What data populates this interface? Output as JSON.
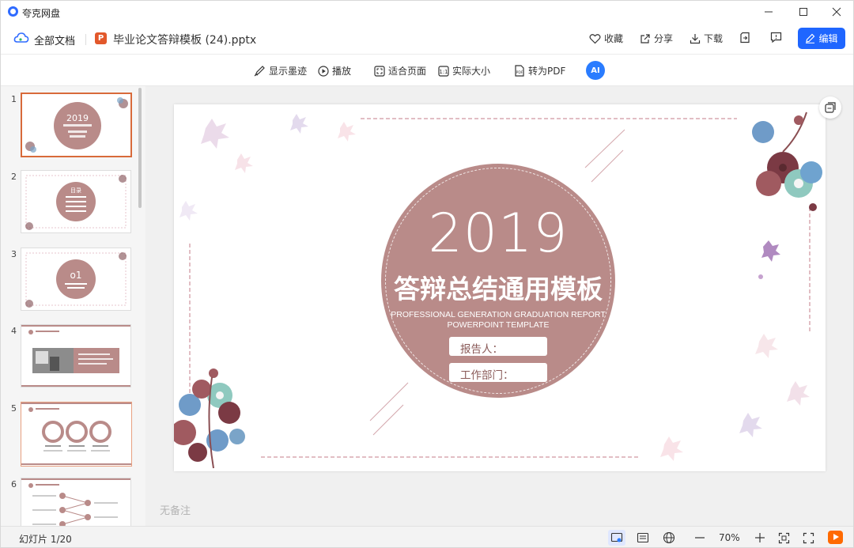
{
  "app": {
    "title": "夸克网盘"
  },
  "header": {
    "all_docs": "全部文档",
    "file_name": "毕业论文答辩模板 (24).pptx",
    "file_icon_letter": "P",
    "favorite": "收藏",
    "share": "分享",
    "download": "下载",
    "edit": "编辑"
  },
  "toolbar": {
    "show_ink": "显示墨迹",
    "play": "播放",
    "fit_page": "适合页面",
    "actual_size": "实际大小",
    "to_pdf": "转为PDF",
    "ai": "AI"
  },
  "sidebar": {
    "thumbs": [
      {
        "num": "1",
        "circle_text": "2019"
      },
      {
        "num": "2",
        "circle_text": "目录"
      },
      {
        "num": "3",
        "circle_text": "o1"
      },
      {
        "num": "4",
        "circle_text": ""
      },
      {
        "num": "5",
        "circle_text": ""
      },
      {
        "num": "6",
        "circle_text": ""
      }
    ]
  },
  "slide": {
    "year": "2019",
    "title_zh": "答辩总结通用模板",
    "subtitle_en_1": "PROFESSIONAL GENERATION GRADUATION REPORT",
    "subtitle_en_2": "POWERPOINT TEMPLATE",
    "reporter_label": "报告人：",
    "department_label": "工作部门："
  },
  "notes": {
    "placeholder": "无备注"
  },
  "status": {
    "page": "幻灯片 1/20",
    "zoom": "70%"
  },
  "colors": {
    "accent": "#1f66ff",
    "slide_circle": "#b98b89",
    "ppt_orange": "#e2582b",
    "selected_border": "#d86a3a"
  }
}
